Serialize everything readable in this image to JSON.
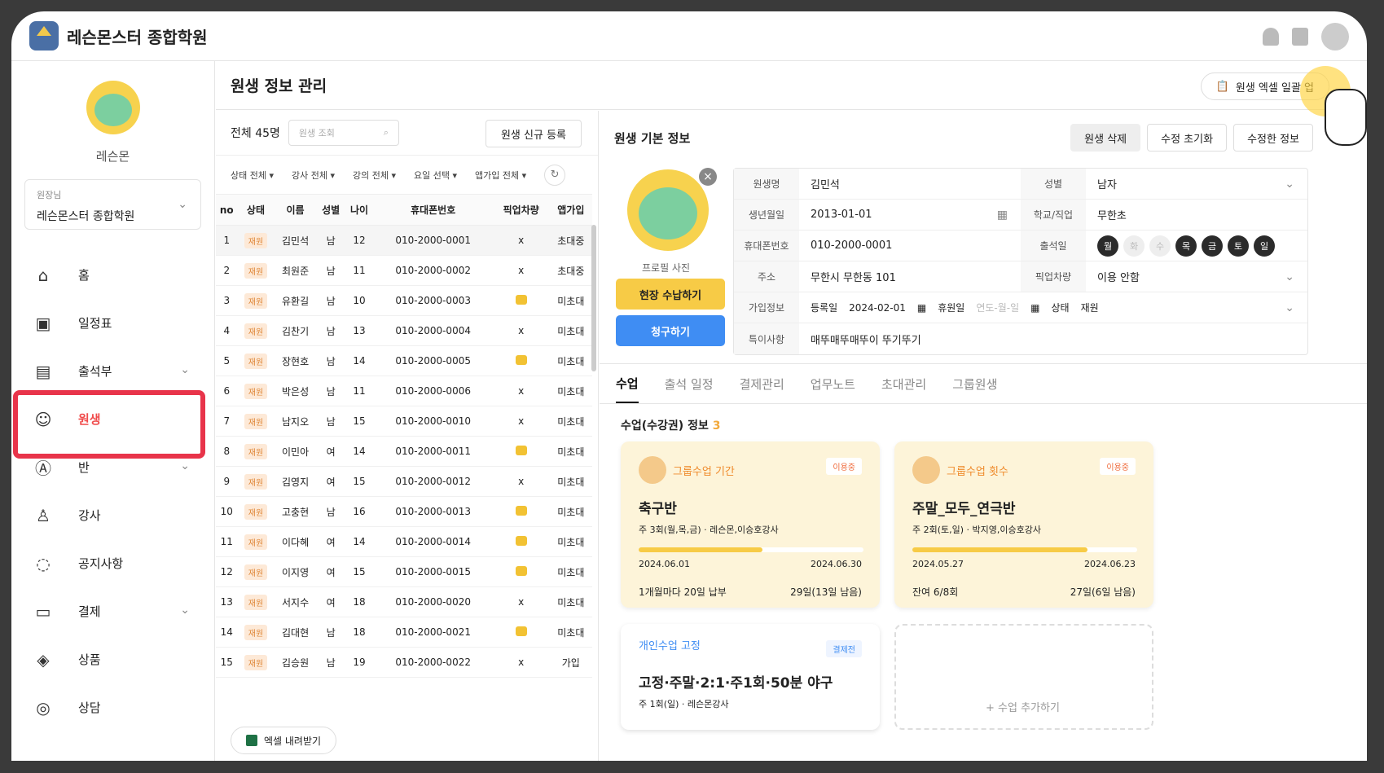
{
  "app": {
    "title": "레슨몬스터 종합학원"
  },
  "profile": {
    "name": "레슨몬",
    "role": "원장님",
    "branch": "레슨몬스터 종합학원"
  },
  "nav": [
    "홈",
    "일정표",
    "출석부",
    "원생",
    "반",
    "강사",
    "공지사항",
    "결제",
    "상품",
    "상담"
  ],
  "page": {
    "title": "원생 정보 관리",
    "excel_upload": "원생 엑셀 일괄 업"
  },
  "list": {
    "total": "전체 45명",
    "search_placeholder": "원생 조회",
    "new_btn": "원생 신규 등록",
    "filters": [
      "상태 전체 ▾",
      "강사 전체 ▾",
      "강의 전체 ▾",
      "요일 선택 ▾",
      "앱가입 전체 ▾"
    ],
    "headers": [
      "no",
      "상태",
      "이름",
      "성별",
      "나이",
      "휴대폰번호",
      "픽업차량",
      "앱가입"
    ],
    "rows": [
      [
        "1",
        "재원",
        "김민석",
        "남",
        "12",
        "010-2000-0001",
        "x",
        "초대중"
      ],
      [
        "2",
        "재원",
        "최원준",
        "남",
        "11",
        "010-2000-0002",
        "x",
        "초대중"
      ],
      [
        "3",
        "재원",
        "유환길",
        "남",
        "10",
        "010-2000-0003",
        "bus",
        "미초대"
      ],
      [
        "4",
        "재원",
        "김찬기",
        "남",
        "13",
        "010-2000-0004",
        "x",
        "미초대"
      ],
      [
        "5",
        "재원",
        "장현호",
        "남",
        "14",
        "010-2000-0005",
        "bus",
        "미초대"
      ],
      [
        "6",
        "재원",
        "박은성",
        "남",
        "11",
        "010-2000-0006",
        "x",
        "미초대"
      ],
      [
        "7",
        "재원",
        "남지오",
        "남",
        "15",
        "010-2000-0010",
        "x",
        "미초대"
      ],
      [
        "8",
        "재원",
        "이민아",
        "여",
        "14",
        "010-2000-0011",
        "bus",
        "미초대"
      ],
      [
        "9",
        "재원",
        "김영지",
        "여",
        "15",
        "010-2000-0012",
        "x",
        "미초대"
      ],
      [
        "10",
        "재원",
        "고충현",
        "남",
        "16",
        "010-2000-0013",
        "bus",
        "미초대"
      ],
      [
        "11",
        "재원",
        "이다혜",
        "여",
        "14",
        "010-2000-0014",
        "bus",
        "미초대"
      ],
      [
        "12",
        "재원",
        "이지영",
        "여",
        "15",
        "010-2000-0015",
        "bus",
        "미초대"
      ],
      [
        "13",
        "재원",
        "서지수",
        "여",
        "18",
        "010-2000-0020",
        "x",
        "미초대"
      ],
      [
        "14",
        "재원",
        "김대현",
        "남",
        "18",
        "010-2000-0021",
        "bus",
        "미초대"
      ],
      [
        "15",
        "재원",
        "김승원",
        "남",
        "19",
        "010-2000-0022",
        "x",
        "가입"
      ]
    ],
    "download": "엑셀 내려받기"
  },
  "detail": {
    "title": "원생 기본 정보",
    "btns": [
      "원생 삭제",
      "수정 초기화",
      "수정한 정보"
    ],
    "photo_label": "프로필 사진",
    "pay_onsite": "현장 수납하기",
    "bill": "청구하기",
    "fields": {
      "name_l": "원생명",
      "name": "김민석",
      "gender_l": "성별",
      "gender": "남자",
      "birth_l": "생년월일",
      "birth": "2013-01-01",
      "school_l": "학교/직업",
      "school": "무한초",
      "phone_l": "휴대폰번호",
      "phone": "010-2000-0001",
      "attend_l": "출석일",
      "addr_l": "주소",
      "addr": "무한시 무한동 101",
      "pickup_l": "픽업차량",
      "pickup": "이용 안함",
      "join_l": "가입정보",
      "reg_l": "등록일",
      "reg": "2024-02-01",
      "leave_l": "휴원일",
      "leave_ph": "연도-월-일",
      "status_l": "상태",
      "status": "재원",
      "note_l": "특이사항",
      "note": "매뚜매뚜매뚜이 뚜기뚜기"
    },
    "days": [
      {
        "d": "월",
        "on": true
      },
      {
        "d": "화",
        "on": false
      },
      {
        "d": "수",
        "on": false
      },
      {
        "d": "목",
        "on": true
      },
      {
        "d": "금",
        "on": true
      },
      {
        "d": "토",
        "on": true
      },
      {
        "d": "일",
        "on": true
      }
    ],
    "tabs": [
      "수업",
      "출석 일정",
      "결제관리",
      "업무노트",
      "초대관리",
      "그룹원생"
    ],
    "section": "수업(수강권) 정보",
    "count": "3"
  },
  "cards": [
    {
      "type": "그룹수업 기간",
      "tag": "이용중",
      "title": "축구반",
      "sub": "주 3회(월,목,금) · 레슨몬,이승호강사",
      "progress": 0.55,
      "start": "2024.06.01",
      "end": "2024.06.30",
      "f1": "1개월마다 20일 납부",
      "f2": "29일(13일 남음)"
    },
    {
      "type": "그룹수업 횟수",
      "tag": "이용중",
      "title": "주말_모두_연극반",
      "sub": "주 2회(토,일) · 박지영,이승호강사",
      "progress": 0.78,
      "start": "2024.05.27",
      "end": "2024.06.23",
      "f1": "잔여 6/8회",
      "f2": "27일(6일 남음)"
    }
  ],
  "card2": {
    "type": "개인수업 고정",
    "tag": "결제전",
    "title": "고정·주말·2:1·주1회·50분 야구",
    "sub": "주 1회(일) · 레슨몬강사"
  },
  "card3": {
    "label": "+ 수업 추가하기"
  }
}
